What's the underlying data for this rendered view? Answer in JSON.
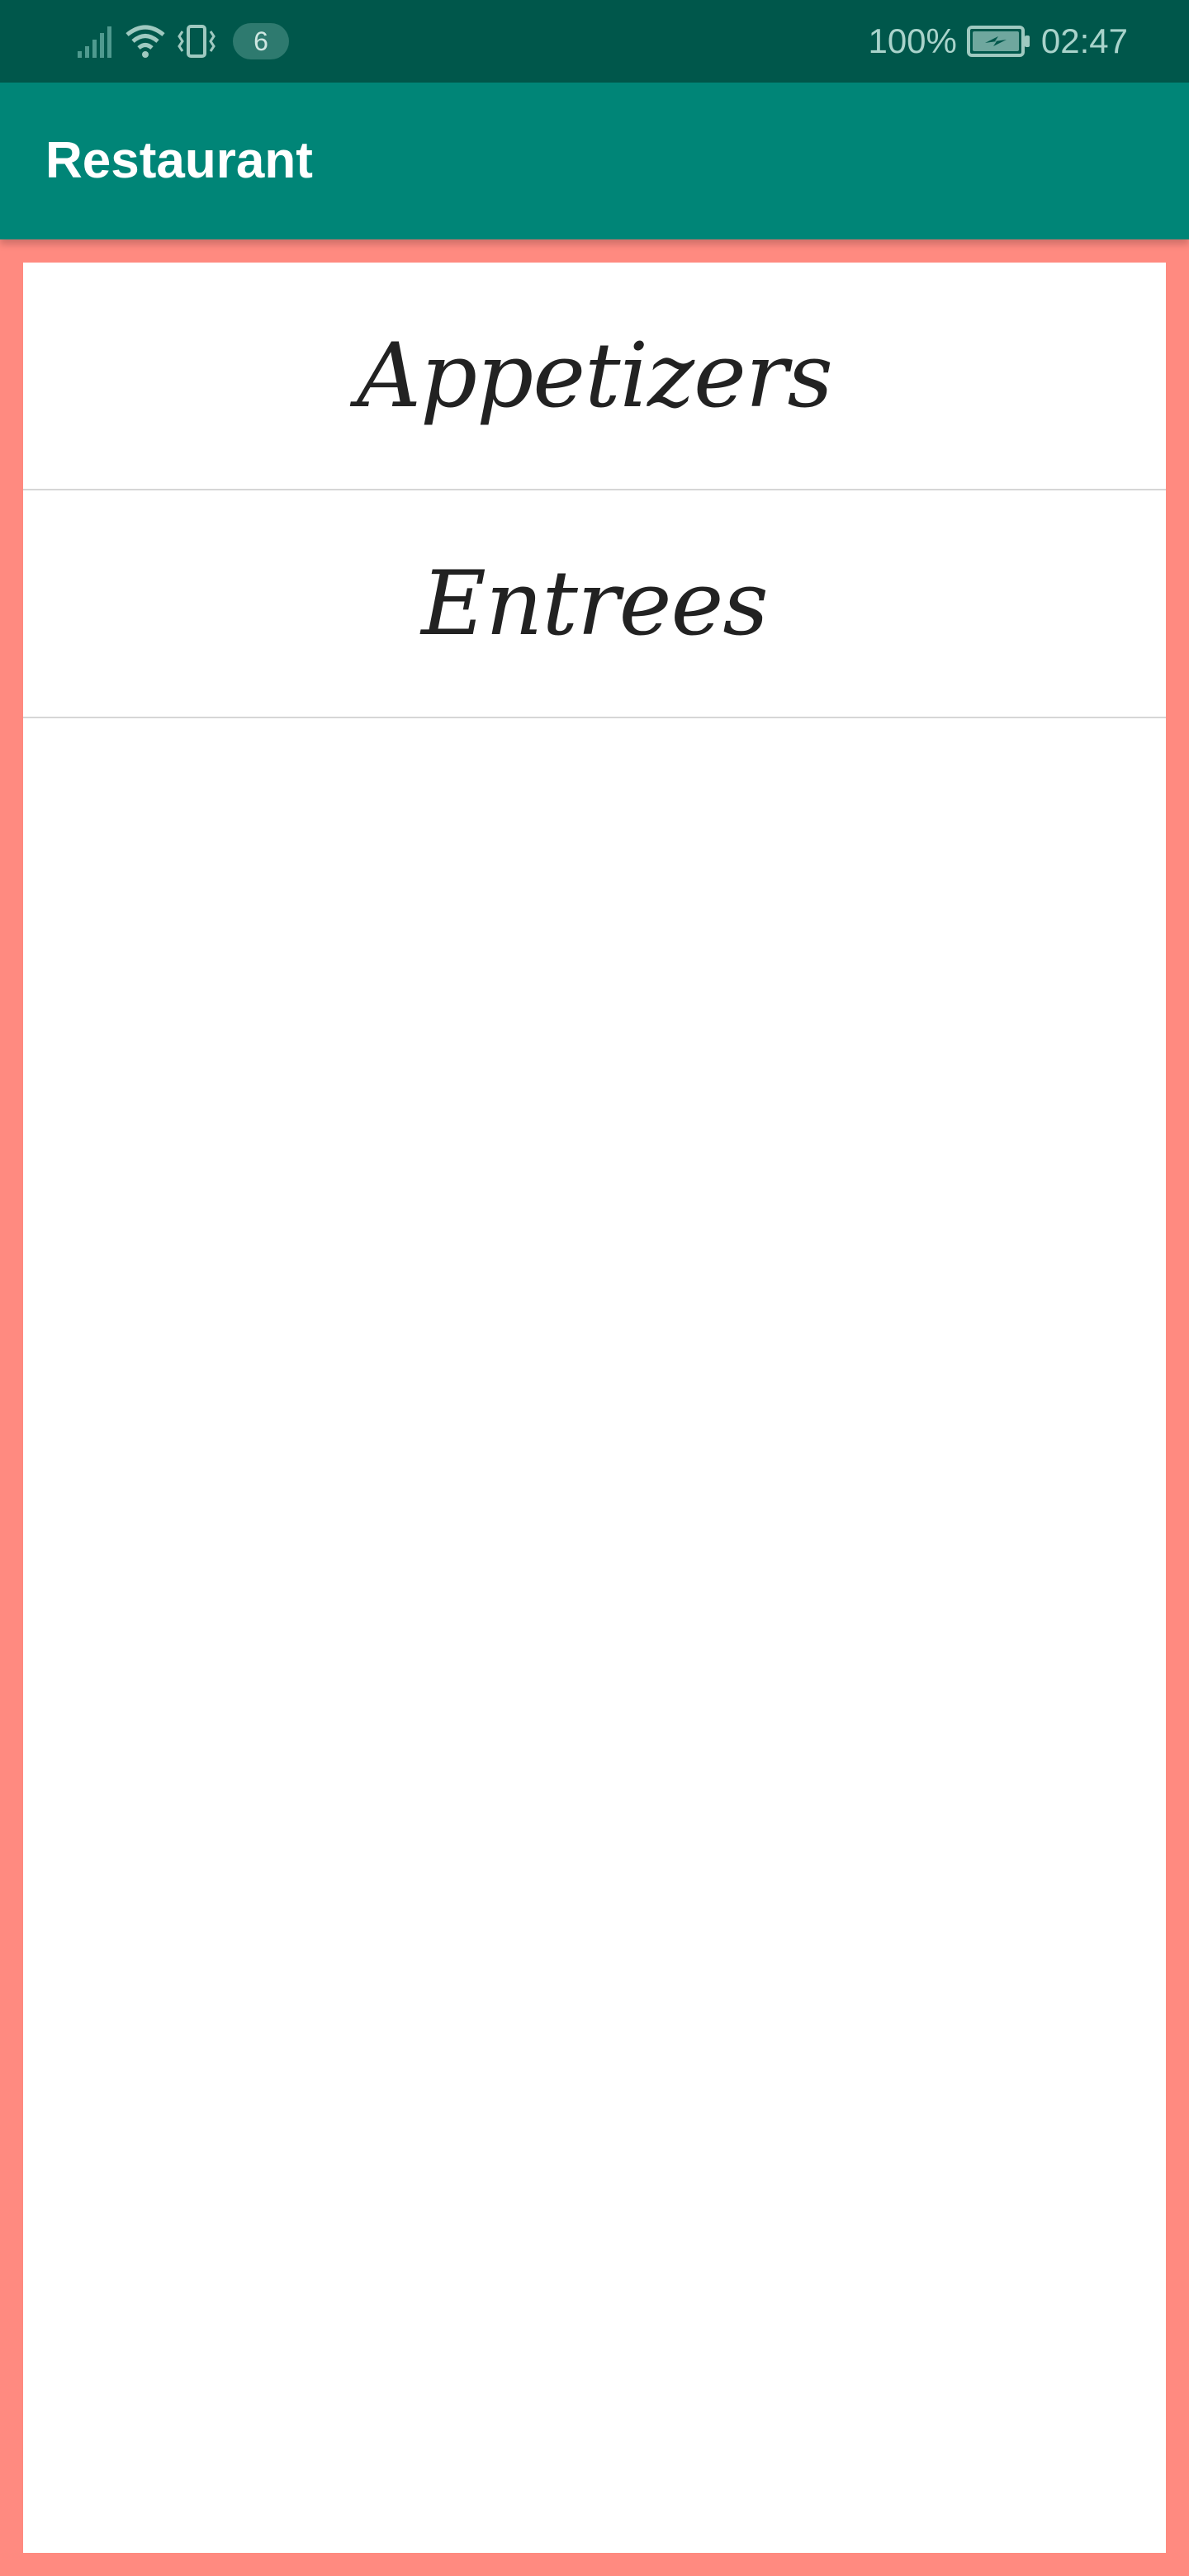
{
  "status_bar": {
    "notification_count": "6",
    "battery_percent": "100%",
    "time": "02:47",
    "icons": [
      "signal-icon",
      "wifi-icon",
      "vibrate-icon",
      "battery-charging-icon"
    ]
  },
  "app_bar": {
    "title": "Restaurant"
  },
  "menu": {
    "items": [
      {
        "label": "Appetizers"
      },
      {
        "label": "Entrees"
      }
    ]
  },
  "colors": {
    "status_bar": "#00574B",
    "app_bar": "#008577",
    "frame_background": "#FF8A80",
    "content_background": "#FFFFFF",
    "divider": "#D6D6D6",
    "item_text": "#222222"
  }
}
